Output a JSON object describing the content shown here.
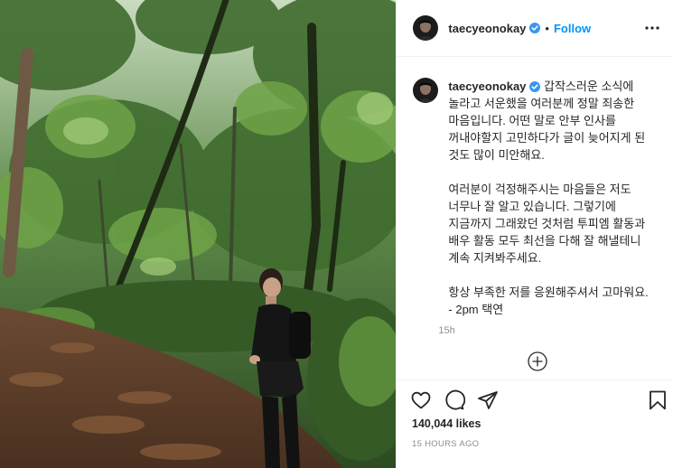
{
  "post": {
    "username": "taecyeonokay",
    "follow_label": "Follow",
    "separator": "•",
    "caption_text": "갑작스러운 소식에 놀라고 서운했을 여러분께 정말 죄송한 마음입니다. 어떤 말로 안부 인사를 꺼내야할지 고민하다가 글이 늦어지게 된 것도 많이 미안해요.\n\n여러분이 걱정해주시는 마음들은 저도 너무나 잘 알고 있습니다. 그렇기에 지금까지 그래왔던 것처럼 투피엠 활동과 배우 활동 모두 최선을 다해 잘 해낼테니 계속 지켜봐주세요.\n\n항상 부족한 저를 응원해주셔서 고마워요.\n- 2pm 택연",
    "caption_time": "15h",
    "likes": "140,044 likes",
    "posted_ago": "15 HOURS AGO"
  },
  "colors": {
    "link": "#0095f6",
    "verified": "#3897f0",
    "secondary_text": "#8e8e8e"
  },
  "icons": [
    "verified-badge-icon",
    "more-options-icon",
    "load-more-comments-icon",
    "heart-icon",
    "comment-icon",
    "share-icon",
    "save-bookmark-icon"
  ]
}
